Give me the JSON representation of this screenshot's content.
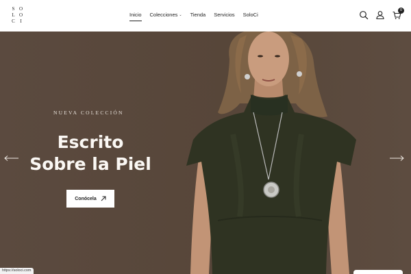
{
  "header": {
    "logo_letters": [
      "S",
      "O",
      "L",
      "O",
      "C",
      "I"
    ],
    "nav": [
      {
        "label": "Inicio",
        "active": true
      },
      {
        "label": "Colecciones",
        "dropdown": true
      },
      {
        "label": "Tienda"
      },
      {
        "label": "Servicios"
      },
      {
        "label": "SoloCi"
      }
    ],
    "icons": [
      "search-icon",
      "account-icon",
      "cart-icon"
    ],
    "cart_count": "0"
  },
  "hero": {
    "kicker": "NUEVA COLECCIÓN",
    "title": "Escrito Sobre la Piel",
    "cta_label": "Conócela",
    "colors": {
      "background": "#56473c",
      "dress": "#2f3322",
      "skin": "#c89b7e",
      "hair": "#8a6a4a"
    }
  },
  "status_bar": {
    "url": "https://soloci.com"
  }
}
